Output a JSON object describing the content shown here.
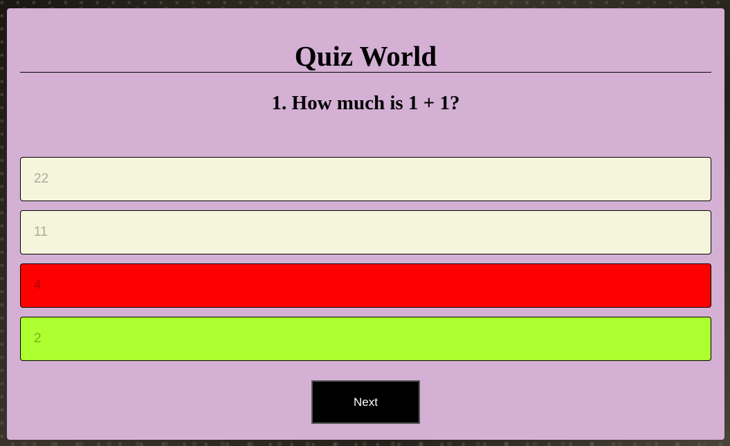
{
  "app": {
    "title": "Quiz World"
  },
  "question": {
    "text": "1. How much is 1 + 1?"
  },
  "answers": [
    {
      "label": "22",
      "state": "neutral",
      "color": "#f5f5dc"
    },
    {
      "label": "11",
      "state": "neutral",
      "color": "#f5f5dc"
    },
    {
      "label": "4",
      "state": "incorrect",
      "color": "#ff0000"
    },
    {
      "label": "2",
      "state": "correct",
      "color": "#adff2f"
    }
  ],
  "controls": {
    "next_label": "Next"
  },
  "colors": {
    "card_background": "#d4b0d4",
    "button_background": "#000000"
  }
}
